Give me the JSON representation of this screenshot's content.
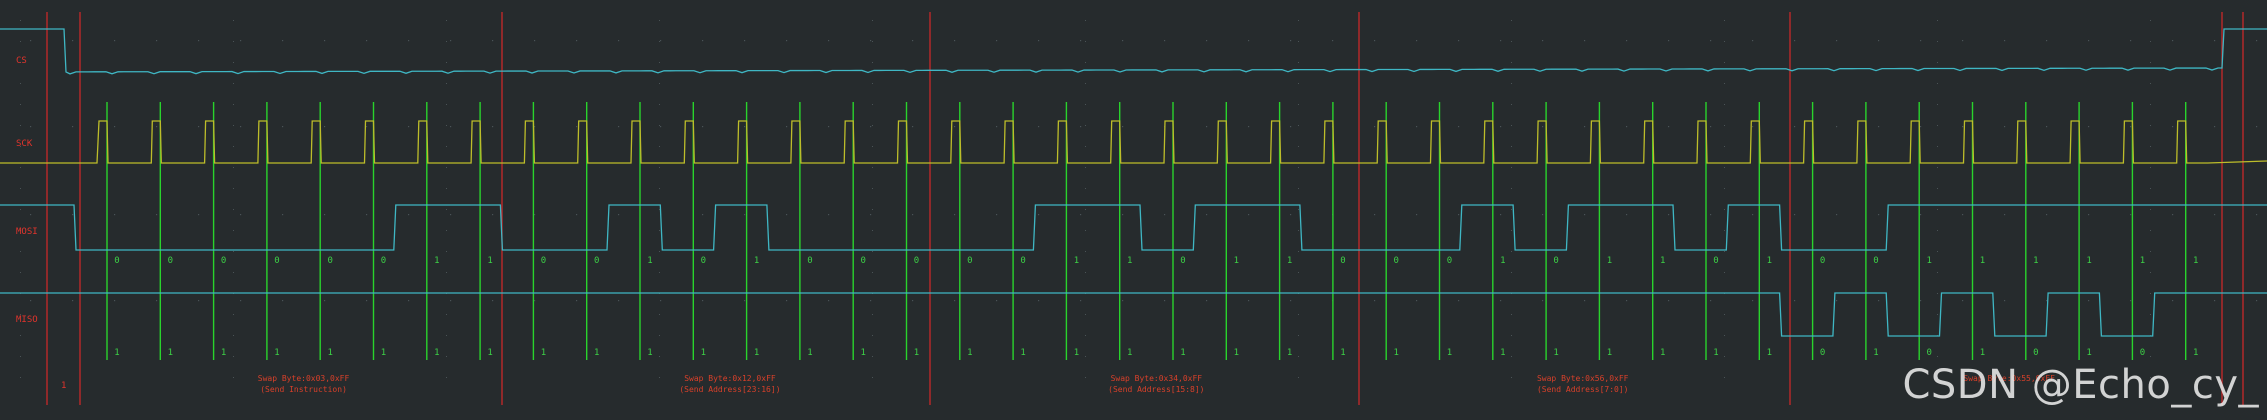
{
  "channels": [
    {
      "name": "CS",
      "color": "#3fb7c4"
    },
    {
      "name": "SCK",
      "color": "#bdbd2a"
    },
    {
      "name": "MOSI",
      "color": "#3fb7c4"
    },
    {
      "name": "MISO",
      "color": "#3fb7c4"
    }
  ],
  "marker_label": "1",
  "watermark": "CSDN @Echo_cy_",
  "colors": {
    "background": "#262b2d",
    "grid_dot": "#4a5356",
    "frame_marker": "#c8282a",
    "clock_marker": "#29d32c",
    "bit_text": "#3cd046",
    "decode_text": "#d8402a"
  },
  "chart_data": {
    "type": "logic-analyzer",
    "clock_edges": 40,
    "bits_per_byte": 8,
    "mosi_bits": "0000001100101000001101100010110100111111",
    "miso_bits": "1111111111111111111111111111111101010101",
    "bytes": [
      {
        "line1": "Swap Byte:0x03,0xFF",
        "line2": "(Send Instruction)"
      },
      {
        "line1": "Swap Byte:0x12,0xFF",
        "line2": "(Send Address[23:16])"
      },
      {
        "line1": "Swap Byte:0x34,0xFF",
        "line2": "(Send Address[15:8])"
      },
      {
        "line1": "Swap Byte:0x56,0xFF",
        "line2": "(Send Address[7:0])"
      },
      {
        "line1": "Swap Byte:0x55,0xFF",
        "line2": ""
      }
    ]
  }
}
